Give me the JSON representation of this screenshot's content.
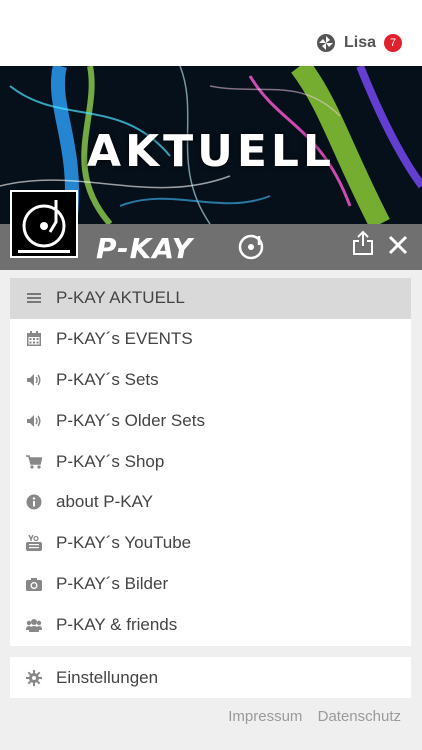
{
  "user": {
    "name": "Lisa",
    "notifications": "7",
    "logo_icon": "swirl-logo-icon"
  },
  "hero": {
    "title": "AKTUELL"
  },
  "brand": {
    "name": "P-KAY",
    "logo_icon": "turntable-logo-icon"
  },
  "actions": {
    "share_icon": "share-icon",
    "close_icon": "close-icon"
  },
  "menu": {
    "items": [
      {
        "label": "P-KAY AKTUELL",
        "icon": "menu-lines-icon",
        "active": true
      },
      {
        "label": "P-KAY´s EVENTS",
        "icon": "calendar-icon"
      },
      {
        "label": "P-KAY´s Sets",
        "icon": "speaker-icon"
      },
      {
        "label": "P-KAY´s Older Sets",
        "icon": "speaker-icon"
      },
      {
        "label": "P-KAY´s Shop",
        "icon": "cart-icon"
      },
      {
        "label": "about P-KAY",
        "icon": "info-icon"
      },
      {
        "label": "P-KAY´s YouTube",
        "icon": "youtube-icon"
      },
      {
        "label": "P-KAY´s Bilder",
        "icon": "camera-icon"
      },
      {
        "label": "P-KAY & friends",
        "icon": "group-icon"
      }
    ]
  },
  "settings": {
    "label": "Einstellungen",
    "icon": "gear-icon"
  },
  "footer": {
    "impressum": "Impressum",
    "datenschutz": "Datenschutz"
  },
  "colors": {
    "badge": "#e0202a",
    "brandbar": "#707070",
    "active_item": "#d9d9d9",
    "background": "#efefef"
  }
}
